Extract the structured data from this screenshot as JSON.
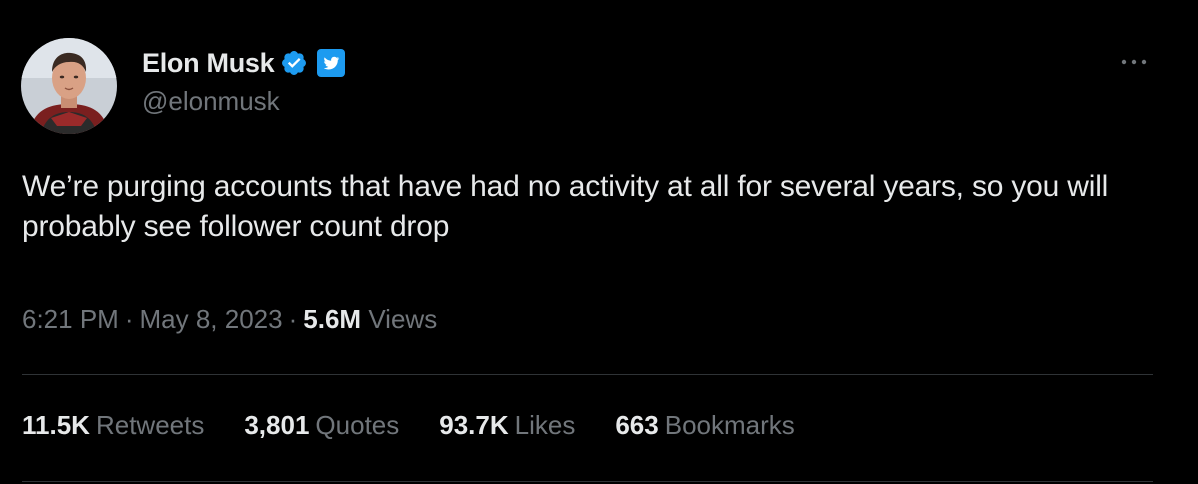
{
  "author": {
    "display_name": "Elon Musk",
    "handle": "@elonmusk",
    "avatar_icon": "profile-photo",
    "verified_icon": "verified-badge-icon",
    "affiliate_icon": "twitter-bird-icon"
  },
  "tweet": {
    "text": "We’re purging accounts that have had no activity at all for several years, so you will probably see follower count drop",
    "time": "6:21 PM",
    "date": "May 8, 2023",
    "separator": "·",
    "views_count": "5.6M",
    "views_label": "Views"
  },
  "stats": [
    {
      "count": "11.5K",
      "label": "Retweets"
    },
    {
      "count": "3,801",
      "label": "Quotes"
    },
    {
      "count": "93.7K",
      "label": "Likes"
    },
    {
      "count": "663",
      "label": "Bookmarks"
    }
  ],
  "colors": {
    "background": "#000000",
    "primary_text": "#e7e9ea",
    "secondary_text": "#71767b",
    "verified_blue": "#1d9bf0",
    "divider": "#2f3336"
  }
}
